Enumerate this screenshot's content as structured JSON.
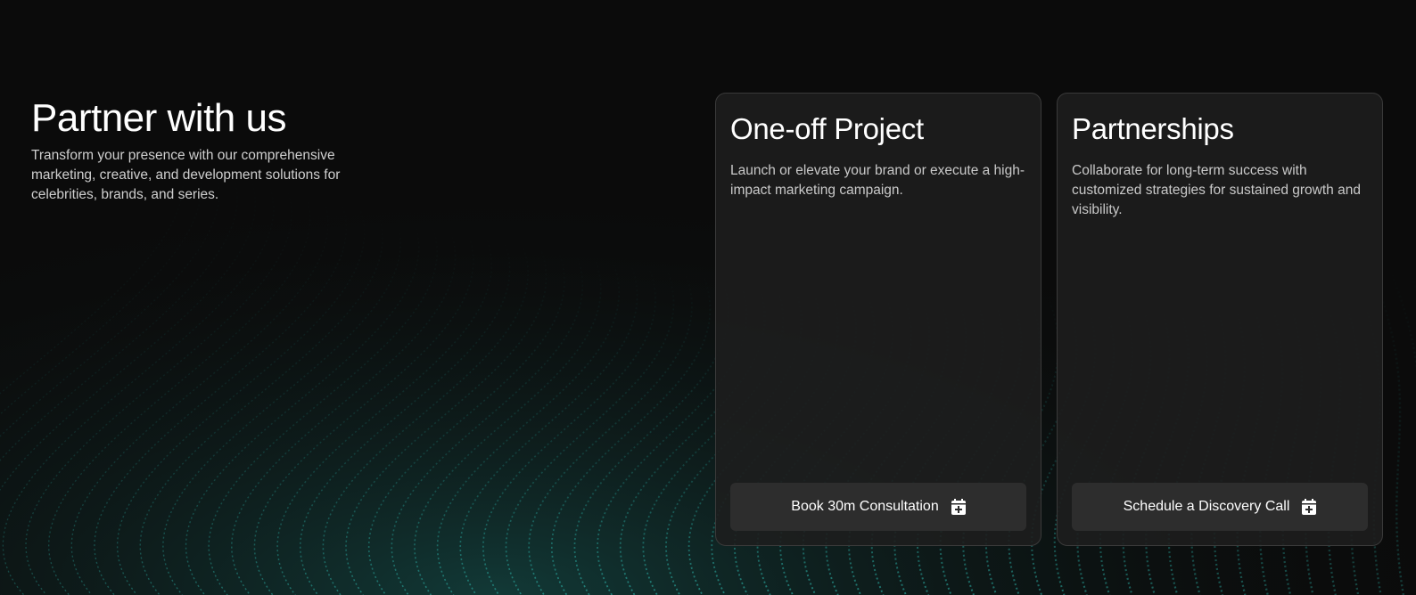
{
  "hero": {
    "title": "Partner with us",
    "subtitle": "Transform your presence with our comprehensive marketing, creative, and development solutions for celebrities, brands, and series."
  },
  "cards": [
    {
      "title": "One-off Project",
      "description": "Launch or elevate your brand or execute a high-impact marketing campaign.",
      "button_label": "Book 30m Consultation",
      "button_icon": "calendar-plus-icon"
    },
    {
      "title": "Partnerships",
      "description": "Collaborate for long-term success with customized strategies for sustained growth and visibility.",
      "button_label": "Schedule a Discovery Call",
      "button_icon": "calendar-plus-icon"
    }
  ],
  "colors": {
    "background": "#0b0b0b",
    "accent_teal": "#1f8f88",
    "card_bg": "#1e1e1e",
    "button_bg": "#2d2d2d"
  }
}
